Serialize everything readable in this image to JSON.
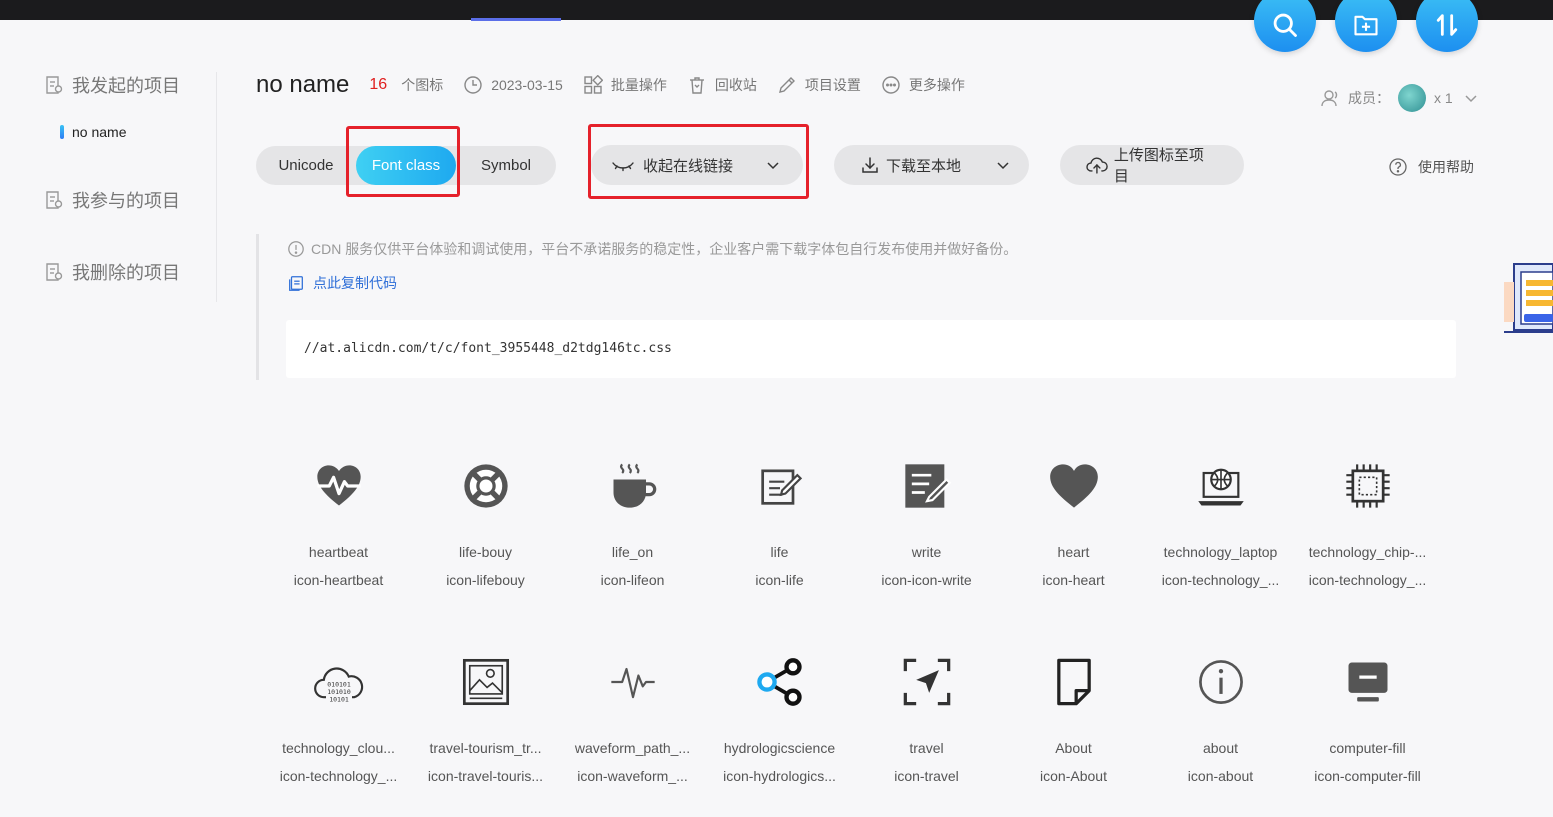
{
  "sidebar": {
    "items": [
      {
        "label": "我发起的项目"
      },
      {
        "label": "我参与的项目"
      },
      {
        "label": "我删除的项目"
      }
    ],
    "current_project": "no name"
  },
  "header": {
    "project_name": "no name",
    "icon_count": "16",
    "icon_count_unit": "个图标",
    "date": "2023-03-15",
    "batch_ops": "批量操作",
    "recycle_bin": "回收站",
    "project_settings": "项目设置",
    "more_ops": "更多操作",
    "members_label": "成员：",
    "members_count": "x 1"
  },
  "tabs": {
    "unicode": "Unicode",
    "font_class": "Font class",
    "symbol": "Symbol",
    "selected": "Font class"
  },
  "actions": {
    "collapse_link": "收起在线链接",
    "download": "下载至本地",
    "upload": "上传图标至项目",
    "help": "使用帮助"
  },
  "notice": {
    "tip": "CDN 服务仅供平台体验和调试使用，平台不承诺服务的稳定性，企业客户需下载字体包自行发布使用并做好备份。",
    "copy_code": "点此复制代码",
    "css_url": "//at.alicdn.com/t/c/font_3955448_d2tdg146tc.css"
  },
  "colors": {
    "accent": "#1ea9f0",
    "highlight_box": "#e5212b",
    "count_red": "#e02020",
    "icon_gray": "#555555"
  },
  "icons": [
    {
      "name": "heartbeat",
      "class": "icon-heartbeat",
      "glyph": "heartbeat-icon"
    },
    {
      "name": "life-bouy",
      "class": "icon-lifebouy",
      "glyph": "lifebuoy-icon"
    },
    {
      "name": "life_on",
      "class": "icon-lifeon",
      "glyph": "coffee-cup-icon"
    },
    {
      "name": "life",
      "class": "icon-life",
      "glyph": "edit-note-icon"
    },
    {
      "name": "write",
      "class": "icon-icon-write",
      "glyph": "write-icon"
    },
    {
      "name": "heart",
      "class": "icon-heart",
      "glyph": "heart-icon"
    },
    {
      "name": "technology_laptop",
      "class": "icon-technology_...",
      "glyph": "laptop-globe-icon"
    },
    {
      "name": "technology_chip-...",
      "class": "icon-technology_...",
      "glyph": "chip-icon"
    },
    {
      "name": "technology_clou...",
      "class": "icon-technology_...",
      "glyph": "cloud-binary-icon"
    },
    {
      "name": "travel-tourism_tr...",
      "class": "icon-travel-touris...",
      "glyph": "landscape-photo-icon"
    },
    {
      "name": "waveform_path_...",
      "class": "icon-waveform_...",
      "glyph": "waveform-icon"
    },
    {
      "name": "hydrologicscience",
      "class": "icon-hydrologics...",
      "glyph": "share-nodes-icon"
    },
    {
      "name": "travel",
      "class": "icon-travel",
      "glyph": "navigation-arrow-icon"
    },
    {
      "name": "About",
      "class": "icon-About",
      "glyph": "document-icon"
    },
    {
      "name": "about",
      "class": "icon-about",
      "glyph": "info-circle-icon"
    },
    {
      "name": "computer-fill",
      "class": "icon-computer-fill",
      "glyph": "monitor-icon"
    }
  ]
}
